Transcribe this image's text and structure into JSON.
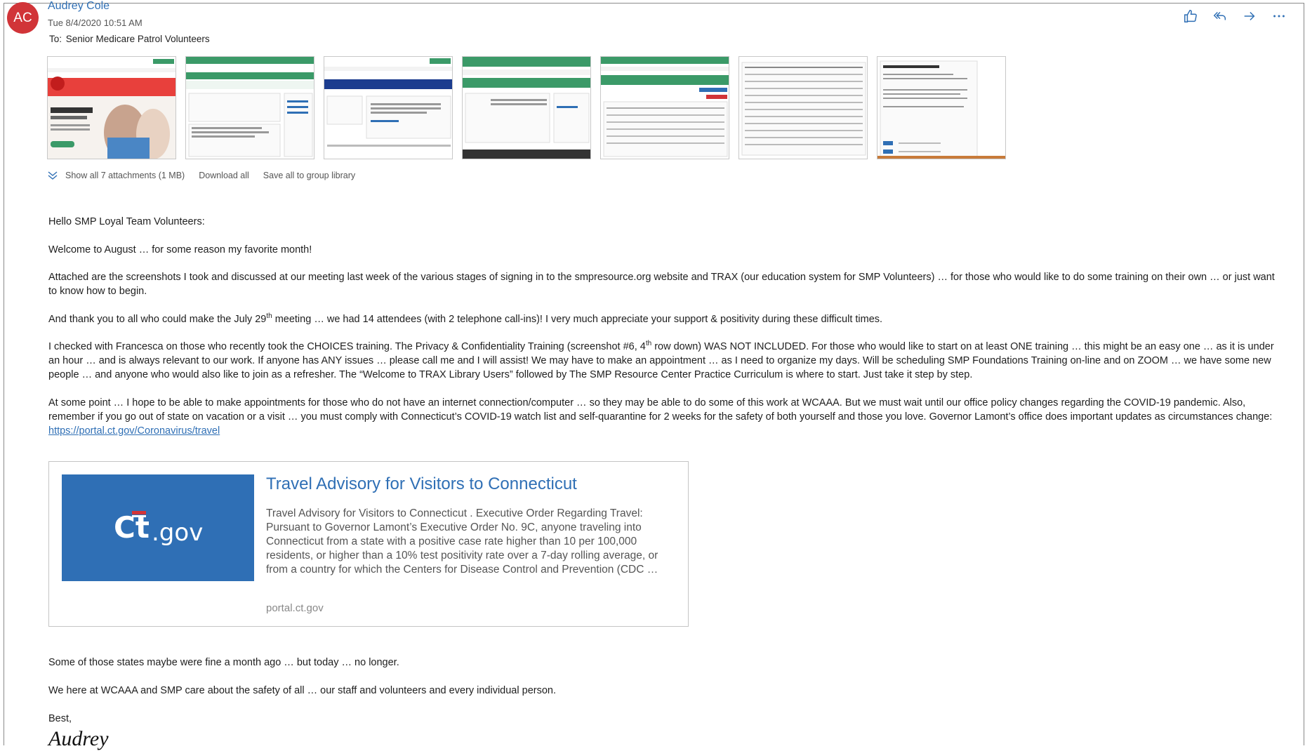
{
  "email": {
    "avatar_initials": "AC",
    "sender": "Audrey Cole",
    "date": "Tue 8/4/2020 10:51 AM",
    "to_label": "To:",
    "to": "Senior Medicare Patrol Volunteers"
  },
  "actions": [
    {
      "name": "like",
      "icon": "thumbs-up-icon"
    },
    {
      "name": "reply-all",
      "icon": "reply-all-icon"
    },
    {
      "name": "forward",
      "icon": "forward-icon"
    },
    {
      "name": "more",
      "icon": "more-icon"
    }
  ],
  "attachments": {
    "count": 7,
    "show_all": "Show all 7 attachments (1 MB)",
    "download_all": "Download all",
    "save_all": "Save all to group library"
  },
  "body": {
    "greeting": "Hello SMP Loyal Team Volunteers:",
    "p1": "Welcome to August … for some reason my favorite month!",
    "p2": "Attached are the screenshots I took and discussed at our meeting last week of the various stages of signing in to the smpresource.org website and TRAX (our education system for SMP Volunteers) … for those who would like to do some training on their own … or just want to know how to begin.",
    "p3_a": "And thank you to all who could make the July 29",
    "p3_sup": "th",
    "p3_b": " meeting … we had 14 attendees (with 2 telephone call-ins)! I very much appreciate your support & positivity during these difficult times.",
    "p4_a": "I checked with Francesca on those who recently took the CHOICES training. The Privacy & Confidentiality Training (screenshot #6, 4",
    "p4_sup": "th",
    "p4_b": " row down) WAS NOT INCLUDED. For those who would like to start on at least ONE training … this might be an easy one … as it is under an hour … and is always relevant to our work. If anyone has ANY issues … please call me and I will assist! We may have to make an appointment … as I need to organize my days. Will be scheduling SMP Foundations Training on-line and on ZOOM … we have some new people … and anyone who would also like to join as a refresher. The “Welcome to TRAX Library Users” followed by The SMP Resource Center Practice Curriculum is where to start. Just take it step by step.",
    "p5": "At some point … I hope to be able to make appointments for those who do not have an internet connection/computer … so they may be able to do some of this work at WCAAA. But we must wait until our office policy changes regarding the COVID-19 pandemic. Also, remember if you go out of state on vacation or a visit … you must comply with Connecticut’s COVID-19 watch list and self-quarantine for 2 weeks for the safety of both yourself and those you love. Governor Lamont’s office does important updates as circumstances change: ",
    "p5_link": "https://portal.ct.gov/Coronavirus/travel"
  },
  "preview": {
    "logo_text": "ct.gov",
    "title": "Travel Advisory for Visitors to Connecticut",
    "description": "Travel Advisory for Visitors to Connecticut . Executive Order Regarding Travel: Pursuant to Governor Lamont’s Executive Order No. 9C, anyone traveling into Connecticut from a state with a positive case rate higher than 10 per 100,000 residents, or higher than a 10% test positivity rate over a 7-day rolling average, or from a country for which the Centers for Disease Control and Prevention (CDC …",
    "domain": "portal.ct.gov"
  },
  "closing": {
    "line1": "Some of those states maybe were fine a month ago … but today … no longer.",
    "line2": "We here at WCAAA and SMP care about the safety of all … our staff and volunteers and every individual person.",
    "best": "Best,",
    "signature": "Audrey"
  },
  "colors": {
    "accent": "#2f6fb5",
    "avatar": "#d13438",
    "thumb_green": "#3b9a68"
  }
}
